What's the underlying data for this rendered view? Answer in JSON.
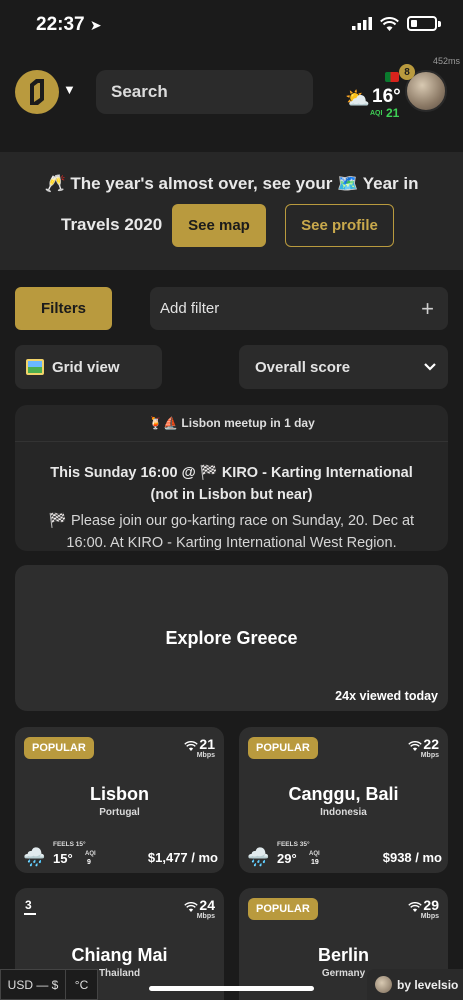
{
  "status": {
    "time": "22:37"
  },
  "header": {
    "search_placeholder": "Search",
    "latency": "452ms",
    "weather": {
      "temp": "16°",
      "aqi_label": "AQI",
      "aqi_value": "21"
    },
    "notification_count": "8"
  },
  "banner": {
    "line1": "🥂 The year's almost over, see your 🗺️ Year in",
    "line2": "Travels 2020",
    "see_map": "See map",
    "see_profile": "See profile"
  },
  "filters": {
    "filters_label": "Filters",
    "add_filter_label": "Add filter",
    "add_icon": "+",
    "grid_view_label": "Grid view",
    "sort_label": "Overall score"
  },
  "meetup": {
    "header": "🍹⛵ Lisbon meetup in 1 day",
    "title_line1": "This Sunday 16:00 @ 🏁 KIRO - Karting International",
    "title_line2": "(not in Lisbon but near)",
    "desc_line1": "🏁 Please join our go-karting race on Sunday, 20. Dec at",
    "desc_line2": "16:00. At KIRO - Karting International West Region."
  },
  "explore": {
    "title": "Explore Greece",
    "views": "24x viewed today"
  },
  "cities": [
    {
      "badge": "POPULAR",
      "rank": "",
      "wifi": "21",
      "wifi_unit": "Mbps",
      "name": "Lisbon",
      "country": "Portugal",
      "feels": "FEELS 15°",
      "temp": "15°",
      "aqi_label": "AQI",
      "aqi": "9",
      "price": "$1,477 / mo"
    },
    {
      "badge": "POPULAR",
      "rank": "",
      "wifi": "22",
      "wifi_unit": "Mbps",
      "name": "Canggu, Bali",
      "country": "Indonesia",
      "feels": "FEELS 35°",
      "temp": "29°",
      "aqi_label": "AQI",
      "aqi": "19",
      "price": "$938 / mo"
    },
    {
      "badge": "",
      "rank": "3",
      "wifi": "24",
      "wifi_unit": "Mbps",
      "name": "Chiang Mai",
      "country": "Thailand"
    },
    {
      "badge": "POPULAR",
      "rank": "",
      "wifi": "29",
      "wifi_unit": "Mbps",
      "name": "Berlin",
      "country": "Germany"
    }
  ],
  "footer": {
    "currency": "USD — $",
    "unit": "°C",
    "byline": "by levelsio"
  },
  "colors": {
    "accent": "#b99a3e",
    "background": "#1b1b1b",
    "card": "#2e2e2e",
    "aqi_good": "#3ed055"
  }
}
